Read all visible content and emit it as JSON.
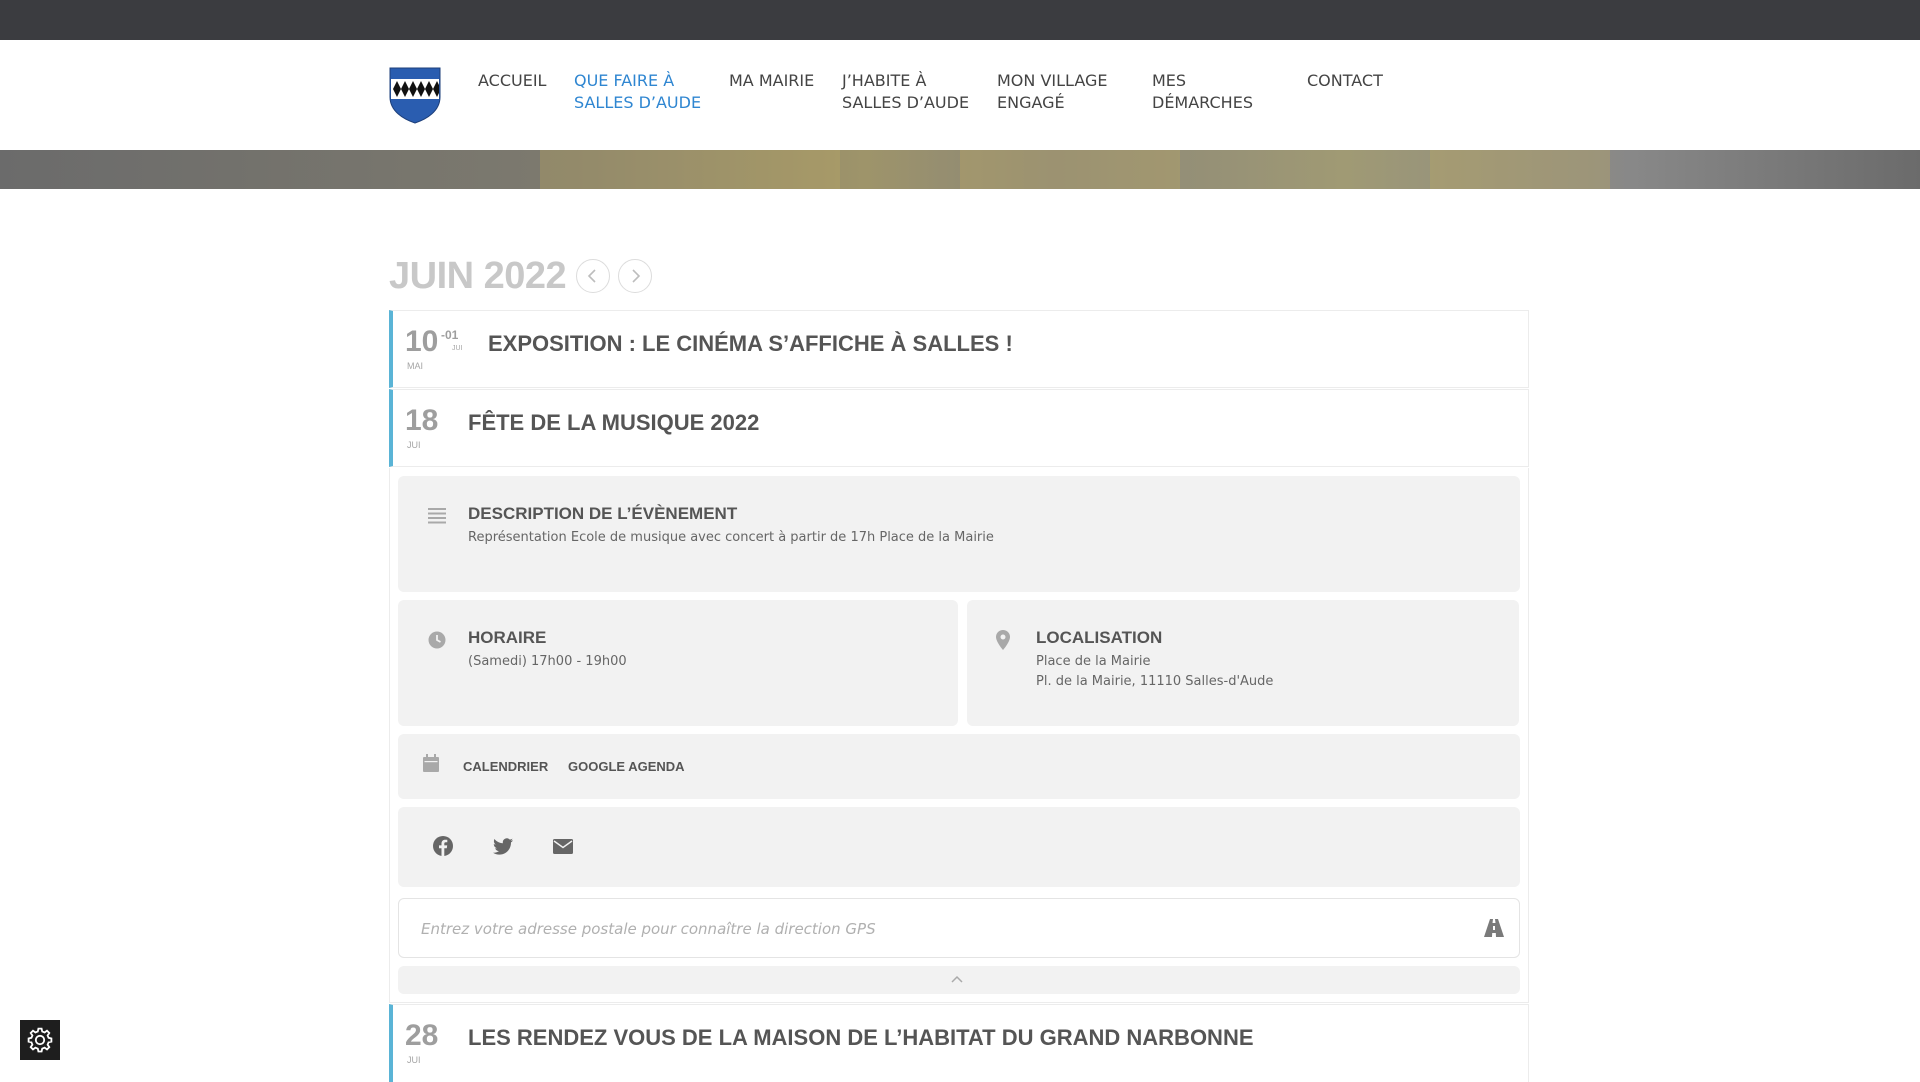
{
  "header": {
    "nav": [
      {
        "label": "ACCUEIL",
        "active": false
      },
      {
        "label": "QUE FAIRE À SALLES D’AUDE",
        "active": true
      },
      {
        "label": "MA MAIRIE",
        "active": false
      },
      {
        "label": "J’HABITE À SALLES D’AUDE",
        "active": false
      },
      {
        "label": "MON VILLAGE ENGAGÉ",
        "active": false
      },
      {
        "label": "MES DÉMARCHES",
        "active": false
      },
      {
        "label": "CONTACT",
        "active": false
      }
    ],
    "logo_icon": "coat-of-arms-icon"
  },
  "calendar": {
    "month_title": "JUIN 2022",
    "prev_icon": "chevron-left-icon",
    "next_icon": "chevron-right-icon"
  },
  "events": [
    {
      "day": "10",
      "range_end": "-01",
      "month": "MAI",
      "end_month": "JUI",
      "title": "EXPOSITION : LE CINÉMA S’AFFICHE À SALLES !"
    },
    {
      "day": "18",
      "month": "JUI",
      "title": "FÊTE DE LA MUSIQUE 2022"
    },
    {
      "day": "28",
      "month": "JUI",
      "title": "LES RENDEZ VOUS DE LA MAISON DE L’HABITAT DU GRAND NARBONNE"
    }
  ],
  "details": {
    "description_heading": "DESCRIPTION DE L’ÉVÈNEMENT",
    "description_text": "Représentation Ecole de musique avec concert à partir de 17h Place de la Mairie",
    "schedule_heading": "HORAIRE",
    "schedule_text": "(Samedi) 17h00 - 19h00",
    "location_heading": "LOCALISATION",
    "location_line1": "Place de la Mairie",
    "location_line2": "Pl. de la Mairie, 11110 Salles-d'Aude",
    "calendar_link": "CALENDRIER",
    "google_link": "GOOGLE AGENDA",
    "gps_placeholder": "Entrez votre adresse postale pour connaître la direction GPS"
  },
  "colors": {
    "accent": "#2f86d1",
    "event_border": "#5ab4d6",
    "topbar": "#3b3c40"
  }
}
